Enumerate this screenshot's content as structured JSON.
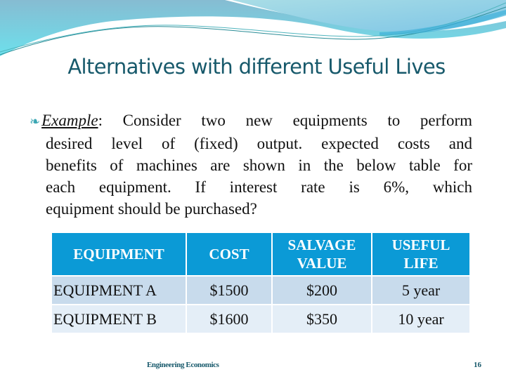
{
  "slide": {
    "title": "Alternatives with different Useful Lives",
    "bullet_icon": "scroll-bullet-icon",
    "body": {
      "label": "Example",
      "lines": [
        ": Consider two new equipments to perform",
        "desired level of (fixed) output. expected costs and",
        "benefits of machines are shown in the below table for",
        "each equipment. If interest rate is 6%, which",
        "equipment should be purchased?"
      ]
    },
    "table": {
      "headers": [
        "EQUIPMENT",
        "COST",
        "SALVAGE VALUE",
        "USEFUL LIFE"
      ],
      "rows": [
        [
          "EQUIPMENT A",
          "$1500",
          "$200",
          "5 year"
        ],
        [
          "EQUIPMENT B",
          "$1600",
          "$350",
          "10 year"
        ]
      ]
    },
    "footer": "Engineering Economics",
    "page_number": "16",
    "colors": {
      "title": "#17596b",
      "table_header": "#0b9ad6",
      "row_odd": "#c8dbec",
      "row_even": "#e4eef7"
    }
  }
}
